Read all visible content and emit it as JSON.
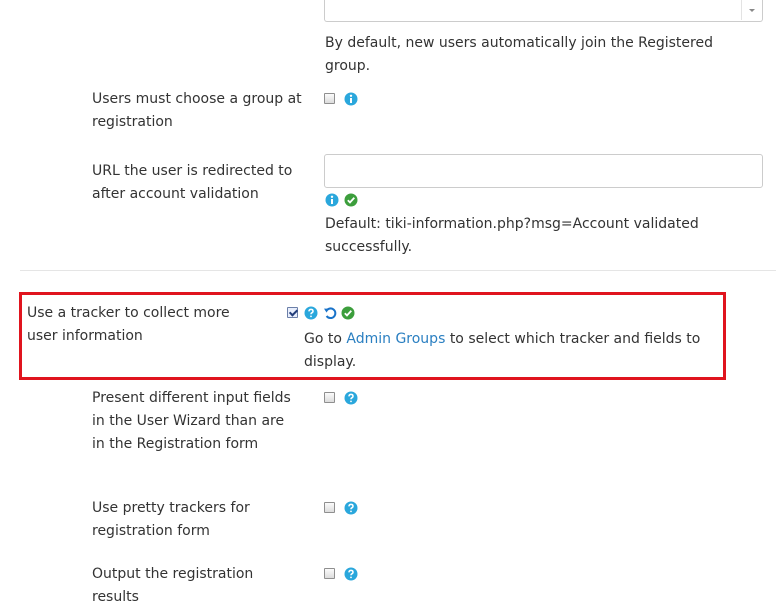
{
  "default_group": {
    "select_value": "",
    "help_text": "By default, new users automatically join the Registered group."
  },
  "choose_group": {
    "label": "Users must choose a group at registration",
    "checked": false
  },
  "redirect_url": {
    "label": "URL the user is redirected to after account validation",
    "value": "",
    "default_text": "Default: tiki-information.php?msg=Account validated successfully."
  },
  "tracker": {
    "label": "Use a tracker to collect more user information",
    "checked": true,
    "note_prefix": "Go to",
    "note_link": "Admin Groups",
    "note_suffix": "to select which tracker and fields to display.",
    "highlight_color": "#e0141e"
  },
  "user_wizard": {
    "label": "Present different input fields in the User Wizard than are in the Registration form",
    "checked": false
  },
  "pretty_trackers": {
    "label": "Use pretty trackers for registration form",
    "checked": false
  },
  "output_results": {
    "label": "Output the registration results",
    "checked": false
  },
  "colors": {
    "info": "#2aa7dc",
    "success": "#3c9e3c",
    "reset": "#1a73c9",
    "link": "#2a7fc1"
  }
}
